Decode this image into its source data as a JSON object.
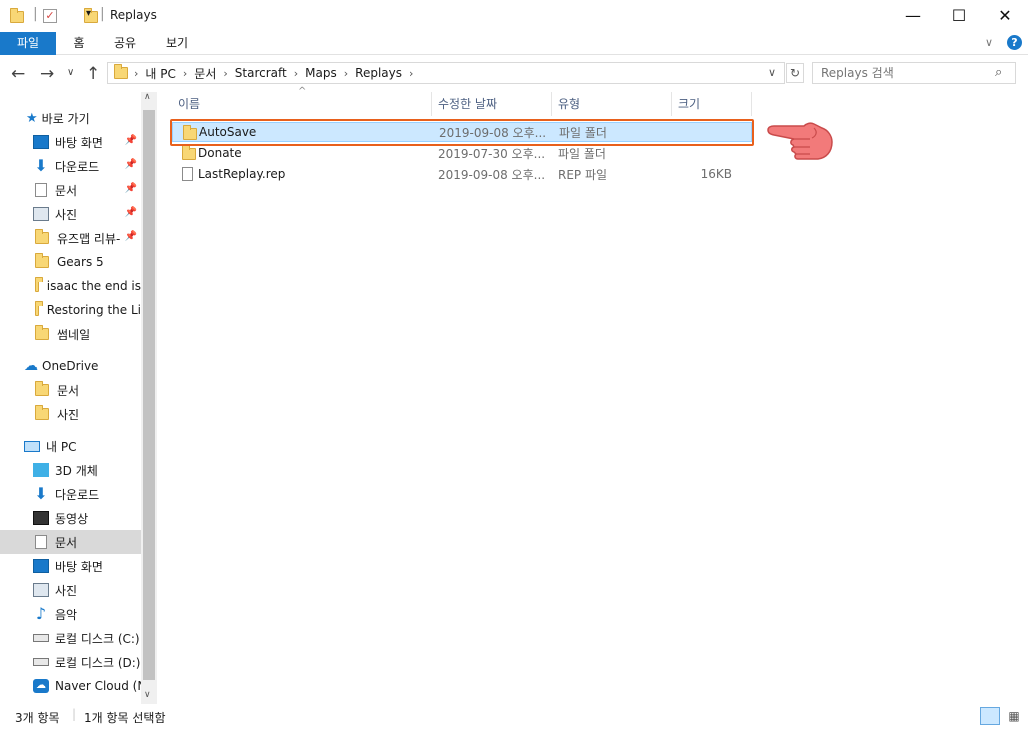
{
  "window": {
    "title": "Replays"
  },
  "ribbon": {
    "tabs": [
      "파일",
      "홈",
      "공유",
      "보기"
    ]
  },
  "address": {
    "crumbs": [
      "내 PC",
      "문서",
      "Starcraft",
      "Maps",
      "Replays"
    ]
  },
  "search": {
    "placeholder": "Replays 검색"
  },
  "sidebar": {
    "quick_access": "바로 가기",
    "quick_items": [
      "바탕 화면",
      "다운로드",
      "문서",
      "사진",
      "유즈맵 리뷰-",
      "Gears 5",
      "isaac the end is",
      "Restoring the Li",
      "썸네일"
    ],
    "onedrive": "OneDrive",
    "onedrive_items": [
      "문서",
      "사진"
    ],
    "this_pc": "내 PC",
    "pc_items": [
      "3D 개체",
      "다운로드",
      "동영상",
      "문서",
      "바탕 화면",
      "사진",
      "음악",
      "로컬 디스크 (C:)",
      "로컬 디스크 (D:)",
      "Naver Cloud (N:"
    ]
  },
  "columns": [
    "이름",
    "수정한 날짜",
    "유형",
    "크기"
  ],
  "files": [
    {
      "name": "AutoSave",
      "date": "2019-09-08 오후...",
      "type": "파일 폴더",
      "size": ""
    },
    {
      "name": "Donate",
      "date": "2019-07-30 오후...",
      "type": "파일 폴더",
      "size": ""
    },
    {
      "name": "LastReplay.rep",
      "date": "2019-09-08 오후...",
      "type": "REP 파일",
      "size": "16KB"
    }
  ],
  "status": {
    "count": "3개 항목",
    "selected": "1개 항목 선택함"
  },
  "colors": {
    "accent": "#1979ca",
    "highlight_box": "#e8601c",
    "selection": "#cce8ff"
  }
}
